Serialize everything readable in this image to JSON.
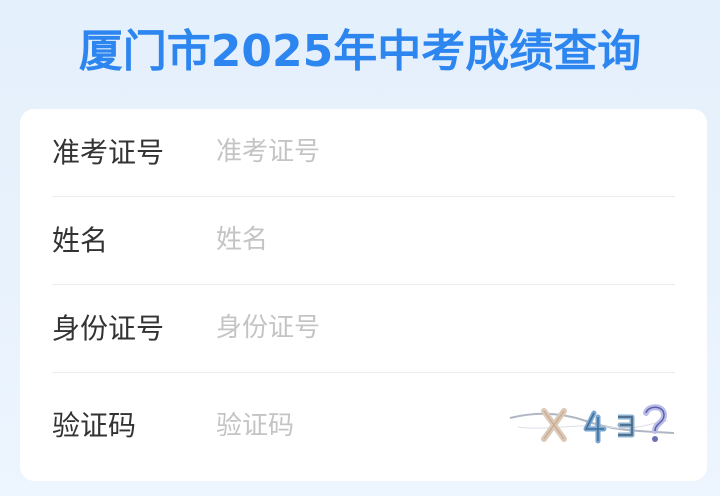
{
  "header": {
    "title": "厦门市2025年中考成绩查询"
  },
  "form": {
    "fields": [
      {
        "label": "准考证号",
        "placeholder": "准考证号",
        "value": ""
      },
      {
        "label": "姓名",
        "placeholder": "姓名",
        "value": ""
      },
      {
        "label": "身份证号",
        "placeholder": "身份证号",
        "value": ""
      },
      {
        "label": "验证码",
        "placeholder": "验证码",
        "value": ""
      }
    ],
    "captcha": {
      "text": "X 4 3 ?"
    }
  },
  "colors": {
    "title": "#2d86f0",
    "label": "#333333",
    "placeholder": "#c4c4c4",
    "card": "#ffffff",
    "divider": "#ececec"
  }
}
